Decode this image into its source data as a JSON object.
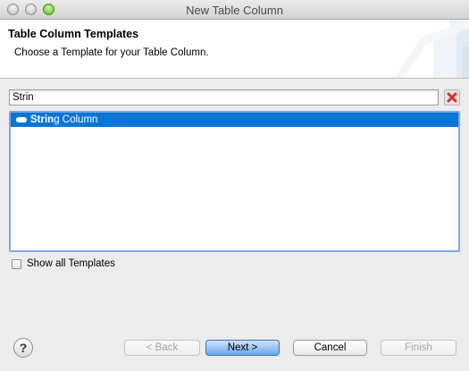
{
  "window": {
    "title": "New Table Column"
  },
  "header": {
    "title": "Table Column Templates",
    "description": "Choose a Template for your Table Column."
  },
  "filter": {
    "value": "Strin"
  },
  "templates": {
    "items": [
      {
        "match": "Strin",
        "rest": "g Column",
        "selected": true
      }
    ]
  },
  "show_all": {
    "label": "Show all Templates",
    "checked": false
  },
  "help": {
    "glyph": "?"
  },
  "buttons": {
    "back": "< Back",
    "next": "Next >",
    "cancel": "Cancel",
    "finish": "Finish"
  },
  "colors": {
    "selection": "#0a75d6",
    "clear_icon": "#d9302b",
    "default_button": "#69a7ef"
  }
}
